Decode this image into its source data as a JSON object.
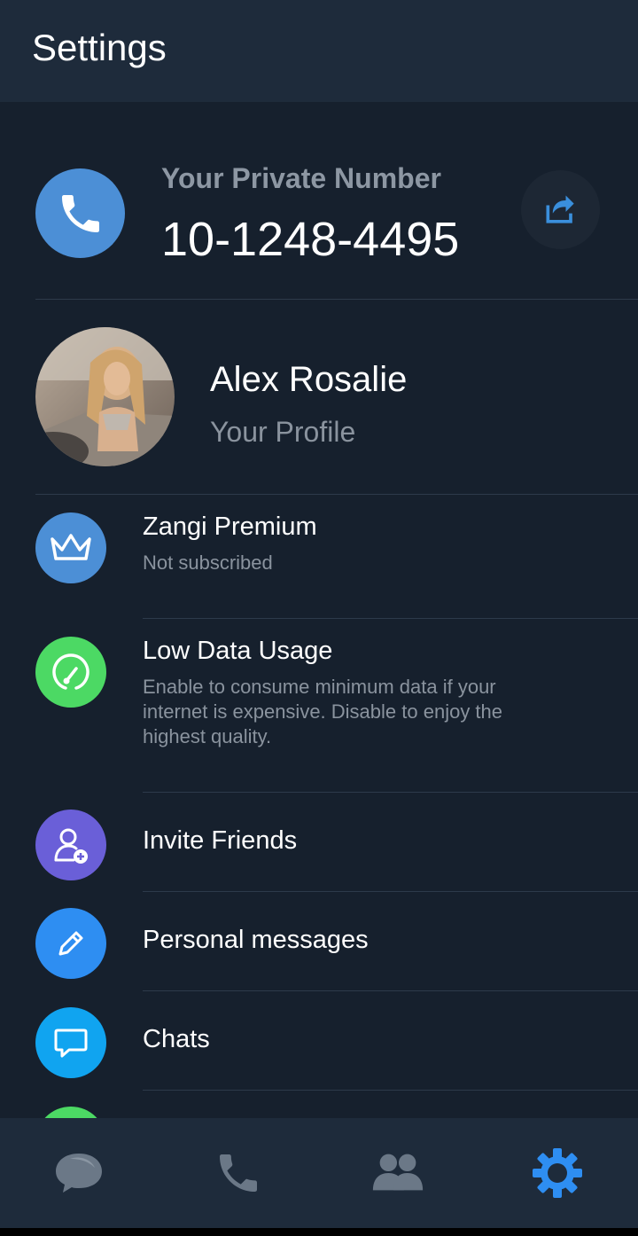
{
  "header": {
    "title": "Settings"
  },
  "private_number": {
    "label": "Your Private Number",
    "number": "10-1248-4495"
  },
  "profile": {
    "name": "Alex Rosalie",
    "subtitle": "Your Profile"
  },
  "items": [
    {
      "title": "Zangi Premium",
      "description": "Not subscribed",
      "icon": "crown-icon",
      "color": "#4c8fd6"
    },
    {
      "title": "Low Data Usage",
      "description": "Enable to consume minimum data if your internet is expensive. Disable to enjoy the highest quality.",
      "icon": "data-gauge-icon",
      "color": "#4cd964"
    },
    {
      "title": "Invite Friends",
      "icon": "add-user-icon",
      "color": "#6a5fd8"
    },
    {
      "title": "Personal messages",
      "icon": "pencil-icon",
      "color": "#2e8ef2"
    },
    {
      "title": "Chats",
      "icon": "chat-bubble-icon",
      "color": "#10a4f0"
    }
  ],
  "bottom_nav": {
    "tabs": [
      "chats-icon",
      "calls-icon",
      "contacts-icon",
      "settings-icon"
    ],
    "active": "settings-icon",
    "active_color": "#2e8ef2",
    "inactive_color": "#6b7887"
  }
}
